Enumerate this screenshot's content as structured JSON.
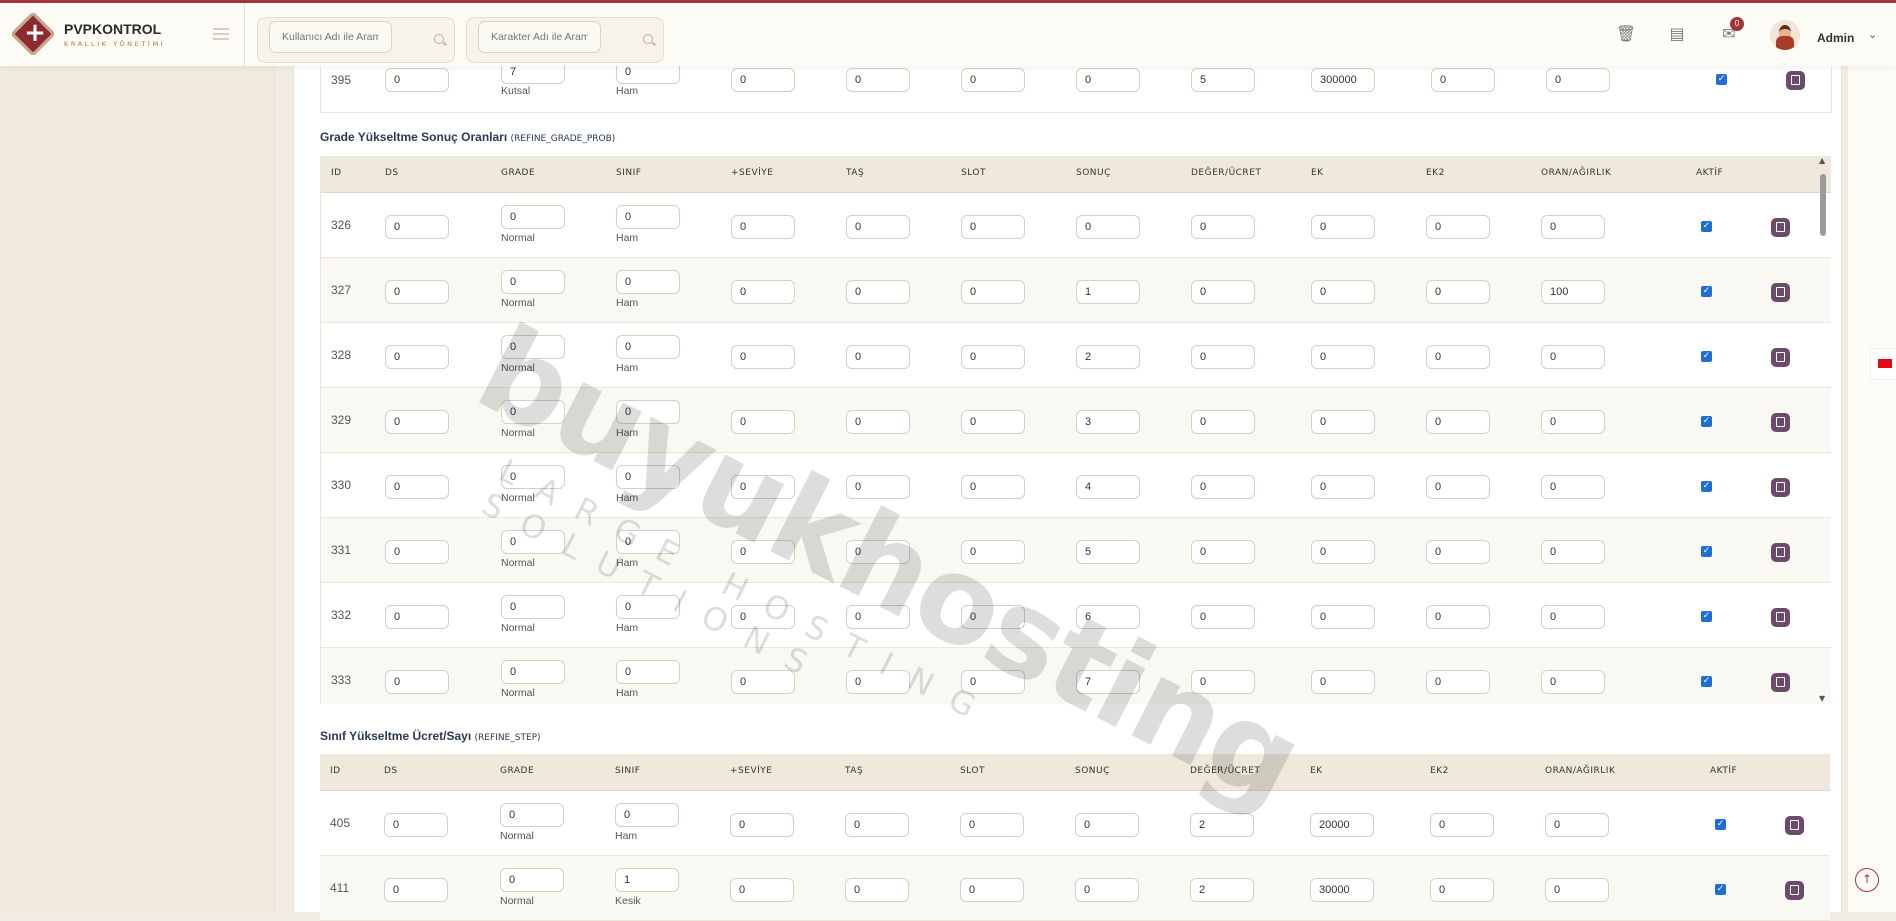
{
  "brand": {
    "name": "PVPKONTROL",
    "subtitle": "KRALLIK YÖNETİMİ"
  },
  "search": {
    "user_placeholder": "Kullanıcı Adı ile Arama",
    "char_placeholder": "Karakter Adı ile Arama"
  },
  "header": {
    "notification_count": "0",
    "user": "Admin"
  },
  "columns": [
    "ID",
    "DS",
    "GRADE",
    "SINIF",
    "+SEVİYE",
    "TAŞ",
    "SLOT",
    "SONUÇ",
    "DEĞER/ÜCRET",
    "EK",
    "EK2",
    "ORAN/AĞIRLIK",
    "AKTİF"
  ],
  "top_row": {
    "id": "395",
    "ds": "0",
    "grade": "7",
    "grade_label": "Kutsal",
    "sinif": "0",
    "sinif_label": "Ham",
    "seviye": "0",
    "tas": "0",
    "slot": "0",
    "sonuc": "0",
    "deger": "5",
    "ek": "300000",
    "ek2": "0",
    "oran": "0"
  },
  "prob_section": {
    "title": "Grade Yükseltme Sonuç Oranları",
    "code": "(REFINE_GRADE_PROB)"
  },
  "prob_rows": [
    {
      "id": "326",
      "ds": "0",
      "grade": "0",
      "grade_label": "Normal",
      "sinif": "0",
      "sinif_label": "Ham",
      "seviye": "0",
      "tas": "0",
      "slot": "0",
      "sonuc": "0",
      "deger": "0",
      "ek": "0",
      "ek2": "0",
      "oran": "0"
    },
    {
      "id": "327",
      "ds": "0",
      "grade": "0",
      "grade_label": "Normal",
      "sinif": "0",
      "sinif_label": "Ham",
      "seviye": "0",
      "tas": "0",
      "slot": "0",
      "sonuc": "1",
      "deger": "0",
      "ek": "0",
      "ek2": "0",
      "oran": "100"
    },
    {
      "id": "328",
      "ds": "0",
      "grade": "0",
      "grade_label": "Normal",
      "sinif": "0",
      "sinif_label": "Ham",
      "seviye": "0",
      "tas": "0",
      "slot": "0",
      "sonuc": "2",
      "deger": "0",
      "ek": "0",
      "ek2": "0",
      "oran": "0"
    },
    {
      "id": "329",
      "ds": "0",
      "grade": "0",
      "grade_label": "Normal",
      "sinif": "0",
      "sinif_label": "Ham",
      "seviye": "0",
      "tas": "0",
      "slot": "0",
      "sonuc": "3",
      "deger": "0",
      "ek": "0",
      "ek2": "0",
      "oran": "0"
    },
    {
      "id": "330",
      "ds": "0",
      "grade": "0",
      "grade_label": "Normal",
      "sinif": "0",
      "sinif_label": "Ham",
      "seviye": "0",
      "tas": "0",
      "slot": "0",
      "sonuc": "4",
      "deger": "0",
      "ek": "0",
      "ek2": "0",
      "oran": "0"
    },
    {
      "id": "331",
      "ds": "0",
      "grade": "0",
      "grade_label": "Normal",
      "sinif": "0",
      "sinif_label": "Ham",
      "seviye": "0",
      "tas": "0",
      "slot": "0",
      "sonuc": "5",
      "deger": "0",
      "ek": "0",
      "ek2": "0",
      "oran": "0"
    },
    {
      "id": "332",
      "ds": "0",
      "grade": "0",
      "grade_label": "Normal",
      "sinif": "0",
      "sinif_label": "Ham",
      "seviye": "0",
      "tas": "0",
      "slot": "0",
      "sonuc": "6",
      "deger": "0",
      "ek": "0",
      "ek2": "0",
      "oran": "0"
    },
    {
      "id": "333",
      "ds": "0",
      "grade": "0",
      "grade_label": "Normal",
      "sinif": "0",
      "sinif_label": "Ham",
      "seviye": "0",
      "tas": "0",
      "slot": "0",
      "sonuc": "7",
      "deger": "0",
      "ek": "0",
      "ek2": "0",
      "oran": "0"
    }
  ],
  "step_section": {
    "title": "Sınıf Yükseltme Ücret/Sayı",
    "code": "(REFINE_STEP)"
  },
  "step_rows": [
    {
      "id": "405",
      "ds": "0",
      "grade": "0",
      "grade_label": "Normal",
      "sinif": "0",
      "sinif_label": "Ham",
      "seviye": "0",
      "tas": "0",
      "slot": "0",
      "sonuc": "0",
      "deger": "2",
      "ek": "20000",
      "ek2": "0",
      "oran": "0"
    },
    {
      "id": "411",
      "ds": "0",
      "grade": "0",
      "grade_label": "Normal",
      "sinif": "1",
      "sinif_label": "Kesik",
      "seviye": "0",
      "tas": "0",
      "slot": "0",
      "sonuc": "0",
      "deger": "2",
      "ek": "30000",
      "ek2": "0",
      "oran": "0"
    }
  ],
  "watermark": {
    "main": "buyukhosting",
    "sub": "LARGE HOSTING SOLUTIONS"
  },
  "colors": {
    "accent": "#a4343c",
    "save": "#6b4a6b",
    "checkbox": "#1f6fd1"
  }
}
